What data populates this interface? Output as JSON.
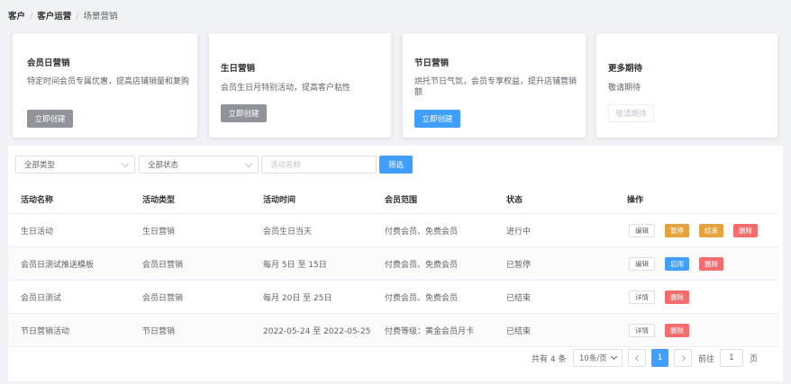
{
  "breadcrumb": [
    "客户",
    "客户运营",
    "场景营销"
  ],
  "cards": [
    {
      "title": "会员日营销",
      "desc": "特定时间会员专属优惠，提高店铺销量和复购",
      "button": "立即创建",
      "button_style": "gray"
    },
    {
      "title": "生日营销",
      "desc": "会员生日月特别活动，提高客户粘性",
      "button": "立即创建",
      "button_style": "gray"
    },
    {
      "title": "节日营销",
      "desc": "烘托节日气氛，会员专享权益，提升店铺营销额",
      "button": "立即创建",
      "button_style": "blue"
    },
    {
      "title": "更多期待",
      "desc": "敬请期待",
      "button": "敬请期待",
      "button_style": "disabled"
    }
  ],
  "filters": {
    "type_select": "全部类型",
    "status_select": "全部状态",
    "name_placeholder": "活动名称",
    "filter_button": "筛选"
  },
  "table": {
    "headers": [
      "活动名称",
      "活动类型",
      "活动时间",
      "会员范围",
      "状态",
      "操作"
    ],
    "rows": [
      {
        "name": "生日活动",
        "type": "生日营销",
        "time": "会员生日当天",
        "scope": "付费会员、免费会员",
        "status": "进行中",
        "actions": [
          "编辑",
          "暂停",
          "结束",
          "删除"
        ]
      },
      {
        "name": "会员日测试推送模板",
        "type": "会员日营销",
        "time": "每月 5日 至 15日",
        "scope": "付费会员、免费会员",
        "status": "已暂停",
        "actions": [
          "编辑",
          "启用",
          "删除"
        ]
      },
      {
        "name": "会员日测试",
        "type": "会员日营销",
        "time": "每月 20日 至 25日",
        "scope": "付费会员、免费会员",
        "status": "已结束",
        "actions": [
          "详情",
          "删除"
        ]
      },
      {
        "name": "节日营销活动",
        "type": "节日营销",
        "time": "2022-05-24 至 2022-05-25",
        "scope": "付费等级：黄金会员月卡",
        "status": "已结束",
        "actions": [
          "详情",
          "删除"
        ]
      }
    ]
  },
  "pagination": {
    "total": "共有 4 条",
    "page_size": "10条/页",
    "current_page": "1",
    "goto_label": "前往",
    "goto_value": "1",
    "page_suffix": "页"
  },
  "colors": {
    "primary": "#409eff",
    "warning": "#e6a23c",
    "danger": "#f56c6c",
    "gray": "#909399"
  }
}
